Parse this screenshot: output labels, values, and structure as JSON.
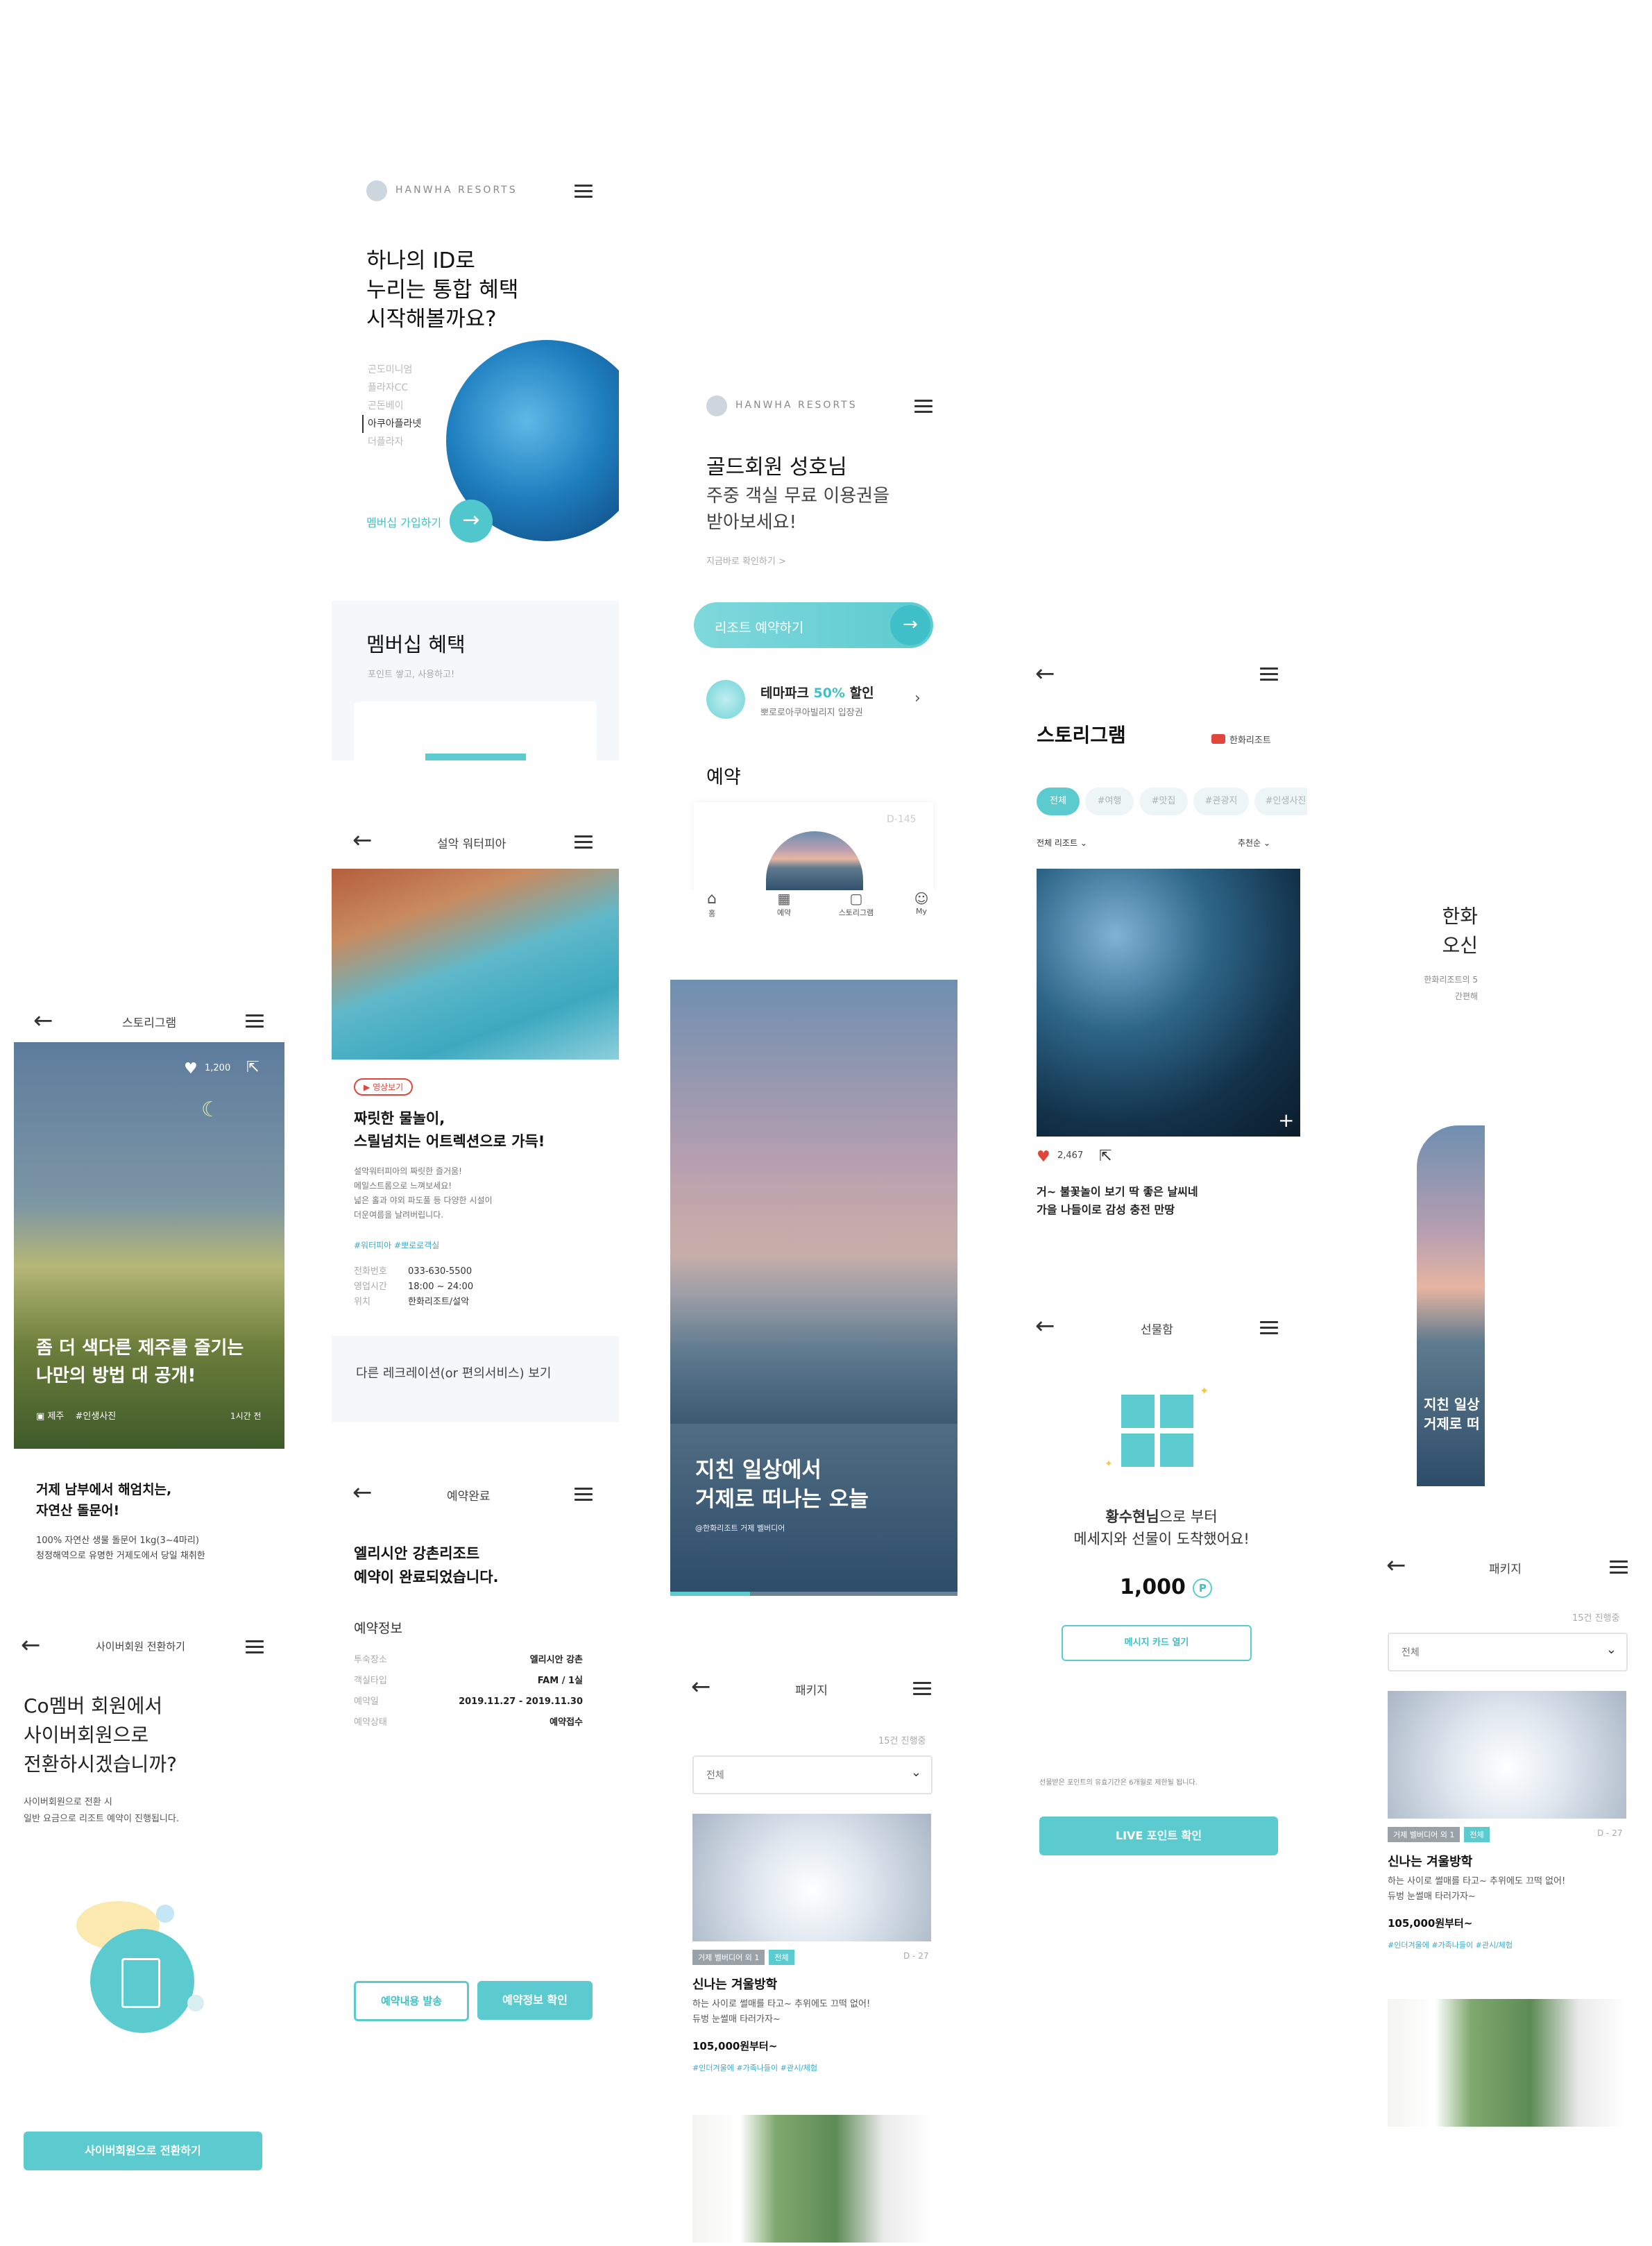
{
  "colors": {
    "accent": "#5ccbd0",
    "accent_dark": "#3fbfc7",
    "text": "#222222",
    "muted": "#888888",
    "red": "#e0463b"
  },
  "membership": {
    "brand": "HANWHA RESORTS",
    "headline": [
      "하나의 ID로",
      "누리는 통합 혜택",
      "시작해볼까요?"
    ],
    "brands": [
      "곤도미니엄",
      "플라자CC",
      "곤돈베이",
      "아쿠아플라넷",
      "더플라자"
    ],
    "cta": "멤버십 가입하기"
  },
  "benefits": {
    "title": "멤버십 혜택",
    "subtitle": "포인트 쌓고, 사용하고!"
  },
  "gold": {
    "brand": "HANWHA RESORTS",
    "title": "골드회원 성호님",
    "subtitle": [
      "주중 객실 무료 이용권을",
      "받아보세요!"
    ],
    "link": "지금바로 확인하기  >",
    "reserve_button": "리조트 예약하기",
    "promo_title_prefix": "테마파크 ",
    "promo_percent": "50%",
    "promo_title_suffix": " 할인",
    "promo_sub": "뽀로로아쿠아빌리지 입장권",
    "section": "예약",
    "dday": "D-145",
    "nav": [
      {
        "icon": "home-icon",
        "label": "홈"
      },
      {
        "icon": "calendar-icon",
        "label": "예약"
      },
      {
        "icon": "story-icon",
        "label": "스토리그램"
      },
      {
        "icon": "user-icon",
        "label": "My"
      }
    ]
  },
  "storygram": {
    "title": "스토리그램",
    "channel": "한화리조트",
    "filters": [
      "전체",
      "#여행",
      "#맛집",
      "#관광지",
      "#인생사진"
    ],
    "sort_left": "전체 리조트",
    "sort_right": "추천순",
    "likes": "2,467",
    "caption": [
      "거~ 불꽃놀이 보기 딱 좋은 날씨네",
      "가을 나들이로 감성 충전 만땅"
    ]
  },
  "storydetail": {
    "title": "스토리그램",
    "likes": "1,200",
    "headline": [
      "좀 더 색다른 제주를 즐기는",
      "나만의 방법 대 공개!"
    ],
    "tag1": "제주",
    "tag2": "#인생사진",
    "time": "1시간 전",
    "body_title": [
      "거제 남부에서 해엄치는,",
      "자연산 돌문어!"
    ],
    "body_text": [
      "100% 자연산 생물 돌문어 1kg(3~4마리)",
      "청정해역으로 유명한 거제도에서 당일 채취한"
    ]
  },
  "waterpark": {
    "title": "설악 워터피아",
    "video_label": "영상보기",
    "headline": [
      "짜릿한 물놀이,",
      "스릴넘치는 어트렉션으로 가득!"
    ],
    "desc": [
      "설악워터피아의 짜릿한 즐거움!",
      "메일스트롬으로 느껴보세요!",
      "넓은 홀과 야외 파도풀 등 다양한 시설이",
      "더운여름을 날려버립니다."
    ],
    "hashtags": "#워터피아 #뽀로로객실",
    "info": [
      {
        "k": "전화번호",
        "v": "033-630-5500"
      },
      {
        "k": "영업시간",
        "v": "18:00 ~ 24:00"
      },
      {
        "k": "위치",
        "v": "한화리조트/설악"
      }
    ],
    "more": "다른 레크레이션(or 편의서비스) 보기"
  },
  "complete": {
    "title": "예약완료",
    "headline": [
      "엘리시안 강촌리조트",
      "예약이 완료되었습니다."
    ],
    "section": "예약정보",
    "rows": [
      {
        "k": "투숙장소",
        "v": "엘리시안 강촌"
      },
      {
        "k": "객실타입",
        "v": "FAM / 1실"
      },
      {
        "k": "예약일",
        "v": "2019.11.27 - 2019.11.30"
      },
      {
        "k": "예약상태",
        "v": "예약접수"
      }
    ],
    "btn_send": "예약내용 발송",
    "btn_check": "예약정보 확인"
  },
  "convert": {
    "title": "사이버회원 전환하기",
    "headline": [
      "Co멤버 회원에서",
      "사이버회원으로",
      "전환하시겠습니까?"
    ],
    "desc": [
      "사이버회원으로 전환 시",
      "일반 요금으로 리조트 예약이 진행됩니다."
    ],
    "button": "사이버회원으로 전환하기"
  },
  "geoje": {
    "headline": [
      "지친 일상에서",
      "거제로 떠나는 오늘"
    ],
    "sub": "@한화리조트 거제 벨버디어"
  },
  "gift": {
    "title": "선물함",
    "from_name": "황수현님",
    "from_suffix": "으로 부터",
    "line2": "메세지와 선물이 도착했어요!",
    "points": "1,000",
    "points_unit": "P",
    "open_button": "메시지 카드 열기",
    "note": "선물받은 포인트의 유효기간은 6개월로 제한될 됩니다.",
    "live_button": "LIVE 포인트 확인"
  },
  "package": {
    "title": "패키지",
    "count": "15건 진행중",
    "select": "전체",
    "tags": [
      "거제 벨버디어 외 1",
      "전체"
    ],
    "dday": "D - 27",
    "name": "신나는 겨울방학",
    "desc": [
      "하는 사이로 썰매를 타고~ 추위에도 끄떡 없어!",
      "듀벙 눈썰매 타러가자~"
    ],
    "price": "105,000원부터~",
    "hashtags": "#인더겨울에 #가족나들이 #관시/체험"
  },
  "partial": {
    "headline": [
      "한화",
      "오신"
    ],
    "sub": [
      "한화리조트의 5",
      "간편해"
    ],
    "bottom": [
      "지친 일상",
      "거제로 떠"
    ]
  }
}
